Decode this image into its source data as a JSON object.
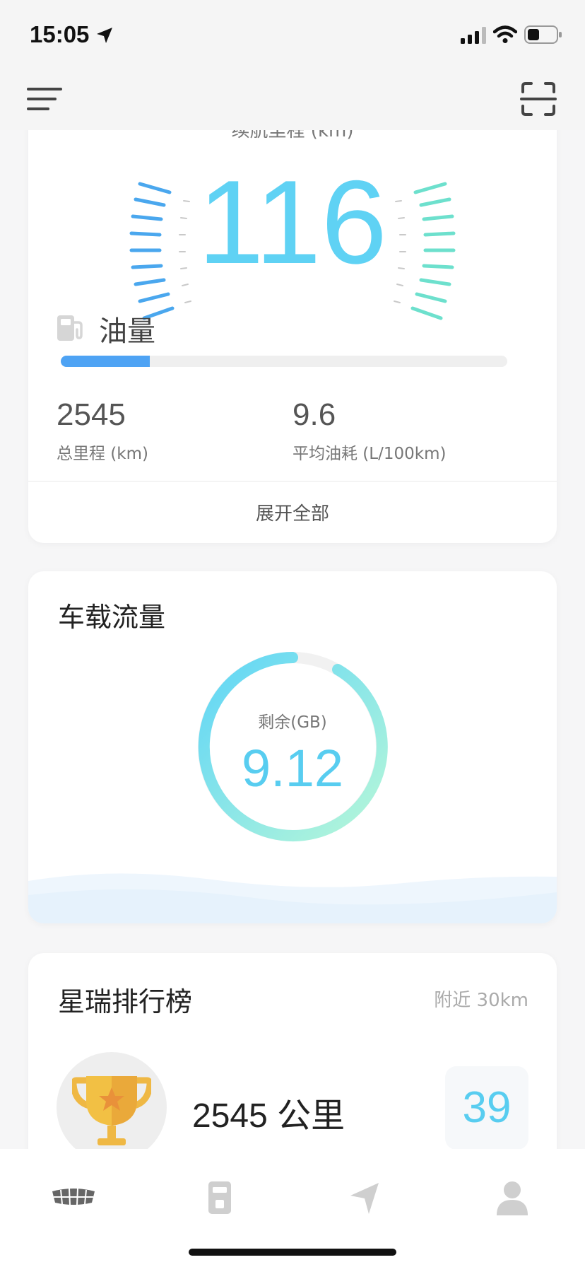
{
  "status_bar": {
    "time": "15:05",
    "icons": [
      "location-arrow-icon",
      "signal-icon",
      "wifi-icon",
      "battery-icon"
    ]
  },
  "nav": {
    "left_icon": "menu-icon",
    "right_icon": "scan-icon"
  },
  "vehicle_card": {
    "range_label": "续航里程 (km)",
    "range_value": "116",
    "fuel_label": "油量",
    "fuel_level": 0.2,
    "total_mileage_value": "2545",
    "total_mileage_label": "总里程 (km)",
    "avg_consumption_value": "9.6",
    "avg_consumption_label": "平均油耗 (L/100km)",
    "expand_label": "展开全部",
    "gauge_colors": {
      "left": "#4aa7ee",
      "right": "#6de0cd"
    }
  },
  "data_card": {
    "title": "车载流量",
    "gauge_label": "剩余(GB)",
    "gauge_value": "9.12",
    "gauge_colors": {
      "start": "#5fd5f7",
      "end": "#b7f7d8"
    }
  },
  "ranking_card": {
    "title": "星瑞排行榜",
    "nearby_label": "附近 30km",
    "distance": "2545 公里",
    "rank": "39"
  },
  "tab_bar": {
    "tabs": [
      {
        "icon": "car-grille-icon",
        "active": true
      },
      {
        "icon": "device-icon",
        "active": false
      },
      {
        "icon": "navigation-icon",
        "active": false
      },
      {
        "icon": "profile-icon",
        "active": false
      }
    ]
  }
}
